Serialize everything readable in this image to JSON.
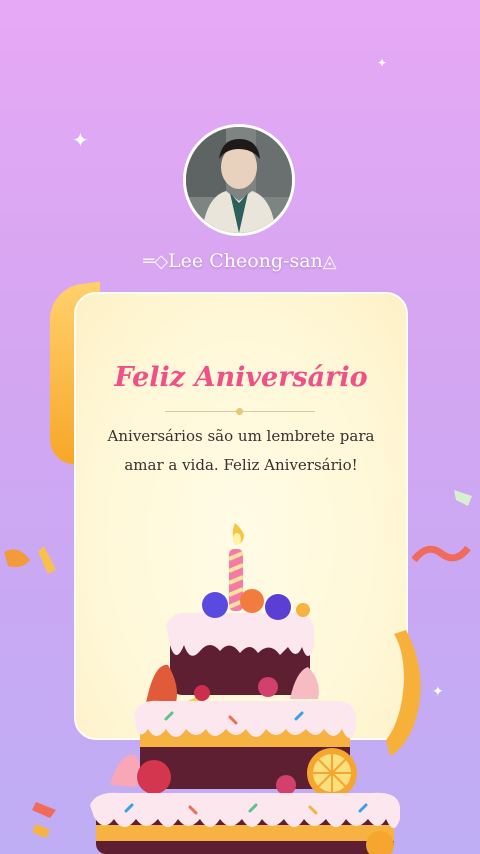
{
  "profile": {
    "name": "Lee Cheong-san"
  },
  "card": {
    "title": "Feliz Aniversário",
    "message": "Aniversários são um lembrete para amar a vida. Feliz Aniversário!"
  },
  "icons": {
    "sparkle": "four-point-star",
    "cake": "birthday-cake",
    "candle": "candle",
    "ribbon": "ribbon"
  },
  "colors": {
    "title": "#f04f87",
    "background_top": "#e6a9f5",
    "background_bottom": "#bfaef5",
    "card": "#fff8d8"
  }
}
